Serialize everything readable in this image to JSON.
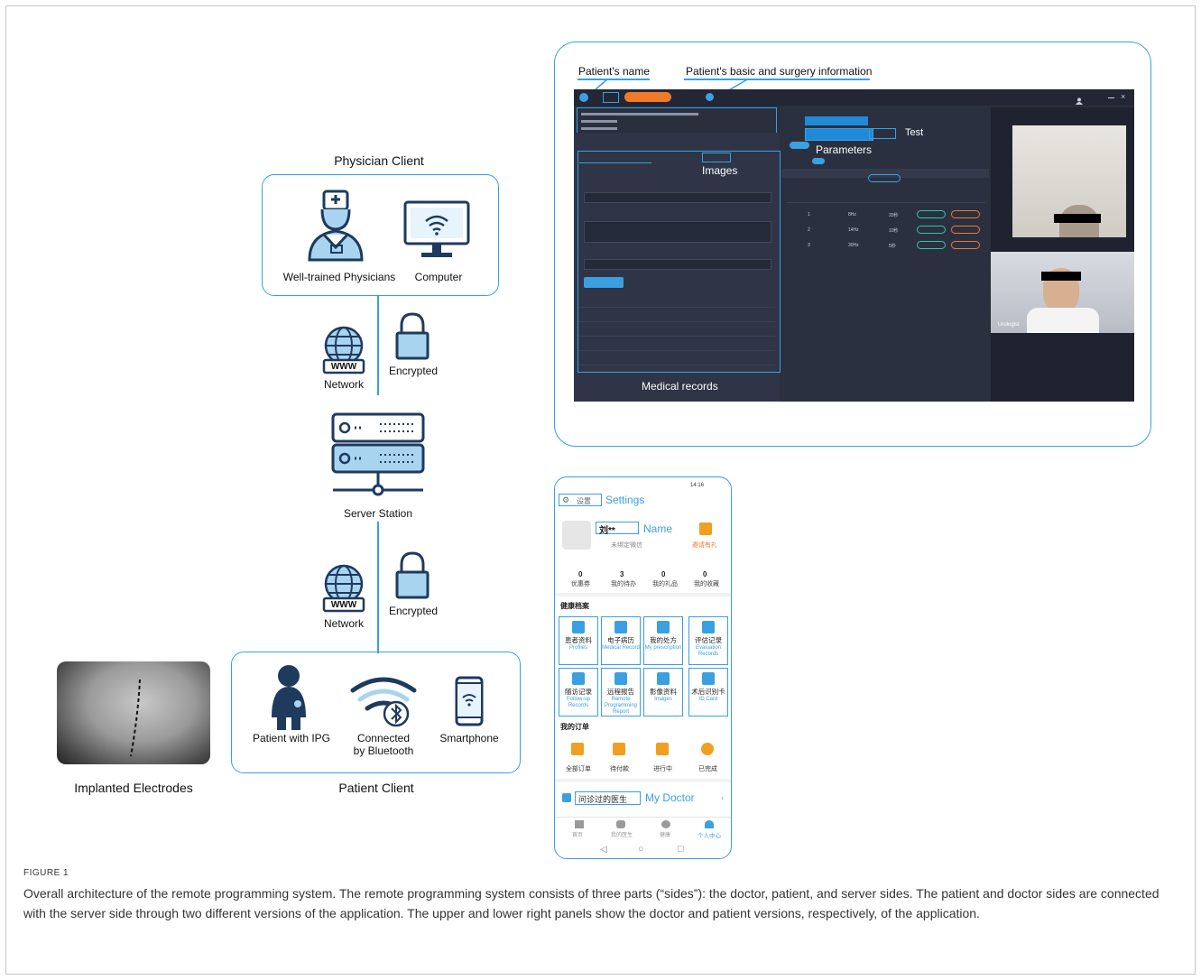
{
  "physician_client": {
    "title": "Physician Client",
    "physician_label": "Well-trained Physicians",
    "computer_label": "Computer"
  },
  "link_top": {
    "network_label": "Network",
    "encrypted_label": "Encrypted",
    "www": "WWW"
  },
  "server": {
    "label": "Server Station"
  },
  "link_bottom": {
    "network_label": "Network",
    "encrypted_label": "Encrypted",
    "www": "WWW"
  },
  "patient_client": {
    "title": "Patient Client",
    "patient_label": "Patient with IPG",
    "bluetooth_label_1": "Connected",
    "bluetooth_label_2": "by Bluetooth",
    "smartphone_label": "Smartphone"
  },
  "implant": {
    "label": "Implanted Electrodes"
  },
  "doctor_app": {
    "annotations": {
      "patient_name": "Patient's name",
      "patient_info": "Patient's basic and surgery information",
      "images": "Images",
      "parameters": "Parameters",
      "test": "Test",
      "medical_records": "Medical records"
    },
    "video_caption": "Urologist",
    "table_rows": [
      {
        "idx": "1",
        "freq": "8Hz",
        "dur": "20秒"
      },
      {
        "idx": "2",
        "freq": "14Hz",
        "dur": "10秒"
      },
      {
        "idx": "3",
        "freq": "30Hz",
        "dur": "5秒"
      }
    ]
  },
  "patient_app": {
    "status_time": "14:16",
    "settings_cn": "设置",
    "settings_en": "Settings",
    "name_cn": "刘**",
    "name_en": "Name",
    "wechat": "未绑定微信",
    "invite": "邀请有礼",
    "stats": [
      {
        "num": "0",
        "label": "优惠券"
      },
      {
        "num": "3",
        "label": "我的待办"
      },
      {
        "num": "0",
        "label": "我的礼品"
      },
      {
        "num": "0",
        "label": "我的收藏"
      }
    ],
    "health_title": "健康档案",
    "grid": [
      {
        "cn": "患者资料",
        "en": "Profiles"
      },
      {
        "cn": "电子病历",
        "en": "Medical Record"
      },
      {
        "cn": "我的处方",
        "en": "My prescription"
      },
      {
        "cn": "评估记录",
        "en": "Evaluation Records"
      },
      {
        "cn": "随访记录",
        "en": "Follow-up Records"
      },
      {
        "cn": "远程报告",
        "en": "Remote Programming Report"
      },
      {
        "cn": "影像资料",
        "en": "Images"
      },
      {
        "cn": "术后识别卡",
        "en": "ID Card"
      }
    ],
    "orders_title": "我的订单",
    "orders": [
      {
        "label": "全部订单",
        "color": "#f0a020"
      },
      {
        "label": "待付款",
        "color": "#f0a020"
      },
      {
        "label": "进行中",
        "color": "#f0a020"
      },
      {
        "label": "已完成",
        "color": "#f0a020"
      }
    ],
    "doctor_cn": "问诊过的医生",
    "doctor_en": "My Doctor",
    "tabs": [
      {
        "label": "首页"
      },
      {
        "label": "我的医生"
      },
      {
        "label": "健康"
      },
      {
        "label": "个人中心"
      }
    ]
  },
  "figure": {
    "label": "FIGURE 1",
    "caption": "Overall architecture of the remote programming system. The remote programming system consists of three parts (“sides”): the doctor, patient, and server sides. The patient and doctor sides are connected with the server side through two different versions of the application. The upper and lower right panels show the doctor and patient versions, respectively, of the application."
  },
  "colors": {
    "accent": "#3aa0e0",
    "dark_navy": "#1e3a5f",
    "light_blue": "#a8d4f0"
  }
}
